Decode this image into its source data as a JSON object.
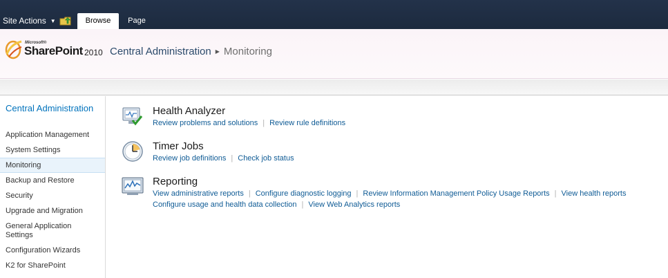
{
  "ribbon": {
    "site_actions": "Site Actions",
    "tabs": [
      {
        "label": "Browse",
        "active": true
      },
      {
        "label": "Page",
        "active": false
      }
    ]
  },
  "logo": {
    "microsoft": "Microsoft®",
    "product": "SharePoint",
    "year": "2010"
  },
  "breadcrumb": {
    "root": "Central Administration",
    "current": "Monitoring"
  },
  "left_nav": {
    "heading": "Central Administration",
    "items": [
      {
        "label": "Application Management",
        "selected": false
      },
      {
        "label": "System Settings",
        "selected": false
      },
      {
        "label": "Monitoring",
        "selected": true
      },
      {
        "label": "Backup and Restore",
        "selected": false
      },
      {
        "label": "Security",
        "selected": false
      },
      {
        "label": "Upgrade and Migration",
        "selected": false
      },
      {
        "label": "General Application Settings",
        "selected": false
      },
      {
        "label": "Configuration Wizards",
        "selected": false
      },
      {
        "label": "K2 for SharePoint",
        "selected": false
      }
    ]
  },
  "sections": [
    {
      "title": "Health Analyzer",
      "icon": "health-analyzer-icon",
      "links": [
        [
          "Review problems and solutions",
          "Review rule definitions"
        ]
      ]
    },
    {
      "title": "Timer Jobs",
      "icon": "clock-icon",
      "links": [
        [
          "Review job definitions",
          "Check job status"
        ]
      ]
    },
    {
      "title": "Reporting",
      "icon": "reporting-monitor-icon",
      "links": [
        [
          "View administrative reports",
          "Configure diagnostic logging",
          "Review Information Management Policy Usage Reports",
          "View health reports"
        ],
        [
          "Configure usage and health data collection",
          "View Web Analytics reports"
        ]
      ]
    }
  ],
  "colors": {
    "ribbon_bg": "#1f2d40",
    "link": "#0f5b95",
    "nav_heading": "#0072bc",
    "selected_nav_bg": "#e9f3fb"
  }
}
